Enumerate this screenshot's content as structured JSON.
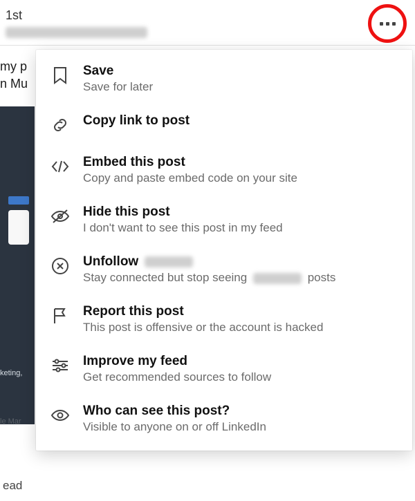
{
  "header": {
    "connection_label": "1st"
  },
  "post": {
    "line1_fragment": "my p",
    "line2_fragment": "n Mu"
  },
  "preview": {
    "label1": "keting,",
    "label2": "le Mar"
  },
  "footer_fragment": "ead",
  "overflow": {
    "aria_label": "More actions"
  },
  "menu": {
    "items": [
      {
        "id": "save",
        "title": "Save",
        "subtitle": "Save for later",
        "icon": "bookmark"
      },
      {
        "id": "copy",
        "title": "Copy link to post",
        "subtitle": "",
        "icon": "link"
      },
      {
        "id": "embed",
        "title": "Embed this post",
        "subtitle": "Copy and paste embed code on your site",
        "icon": "code"
      },
      {
        "id": "hide",
        "title": "Hide this post",
        "subtitle": "I don't want to see this post in my feed",
        "icon": "eye-off"
      },
      {
        "id": "unfollow",
        "title_prefix": "Unfollow",
        "subtitle_prefix": "Stay connected but stop seeing",
        "subtitle_suffix": "posts",
        "icon": "x-circle",
        "redacted": true
      },
      {
        "id": "report",
        "title": "Report this post",
        "subtitle": "This post is offensive or the account is hacked",
        "icon": "flag"
      },
      {
        "id": "improve",
        "title": "Improve my feed",
        "subtitle": "Get recommended sources to follow",
        "icon": "sliders"
      },
      {
        "id": "visibility",
        "title": "Who can see this post?",
        "subtitle": "Visible to anyone on or off LinkedIn",
        "icon": "eye"
      }
    ]
  }
}
